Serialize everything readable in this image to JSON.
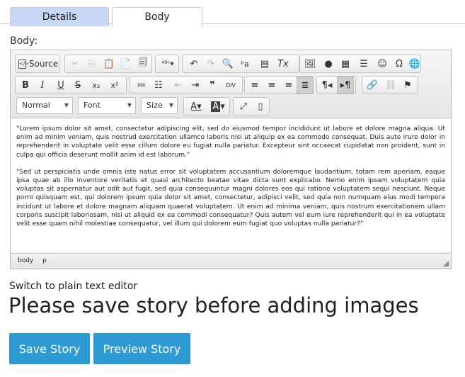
{
  "tabs": [
    {
      "label": "Details"
    },
    {
      "label": "Body"
    }
  ],
  "field_label": "Body:",
  "toolbar": {
    "source_label": "Source",
    "format_combo": "Normal",
    "font_combo": "Font",
    "size_combo": "Size"
  },
  "content": {
    "paragraphs": [
      "\"Lorem ipsum dolor sit amet, consectetur adipiscing elit, sed do eiusmod tempor incididunt ut labore et dolore magna aliqua. Ut enim ad minim veniam, quis nostrud exercitation ullamco laboris nisi ut aliquip ex ea commodo consequat. Duis aute irure dolor in reprehenderit in voluptate velit esse cillum dolore eu fugiat nulla pariatur. Excepteur sint occaecat cupidatat non proident, sunt in culpa qui officia deserunt mollit anim id est laborum.\"",
      "\"Sed ut perspiciatis unde omnis iste natus error sit voluptatem accusantium doloremque laudantium, totam rem aperiam, eaque ipsa quae ab illo inventore veritatis et quasi architecto beatae vitae dicta sunt explicabo. Nemo enim ipsam voluptatem quia voluptas sit aspernatur aut odit aut fugit, sed quia consequuntur magni dolores eos qui ratione voluptatem sequi nesciunt. Neque porro quisquam est, qui dolorem ipsum quia dolor sit amet, consectetur, adipisci velit, sed quia non numquam eius modi tempora incidunt ut labore et dolore magnam aliquam quaerat voluptatem. Ut enim ad minima veniam, quis nostrum exercitationem ullam corporis suscipit laboriosam, nisi ut aliquid ex ea commodi consequatur? Quis autem vel eum iure reprehenderit qui in ea voluptate velit esse quam nihil molestiae consequatur, vel illum qui dolorem eum fugiat quo voluptas nulla pariatur?\""
    ]
  },
  "pathbar": {
    "items": [
      "body",
      "p"
    ]
  },
  "plain_text_link": "Switch to plain text editor",
  "notice": "Please save story before adding images",
  "buttons": {
    "save": "Save Story",
    "preview": "Preview Story"
  },
  "colors": {
    "accent": "#2d9ad3",
    "active_tab": "#c8d7f5"
  }
}
